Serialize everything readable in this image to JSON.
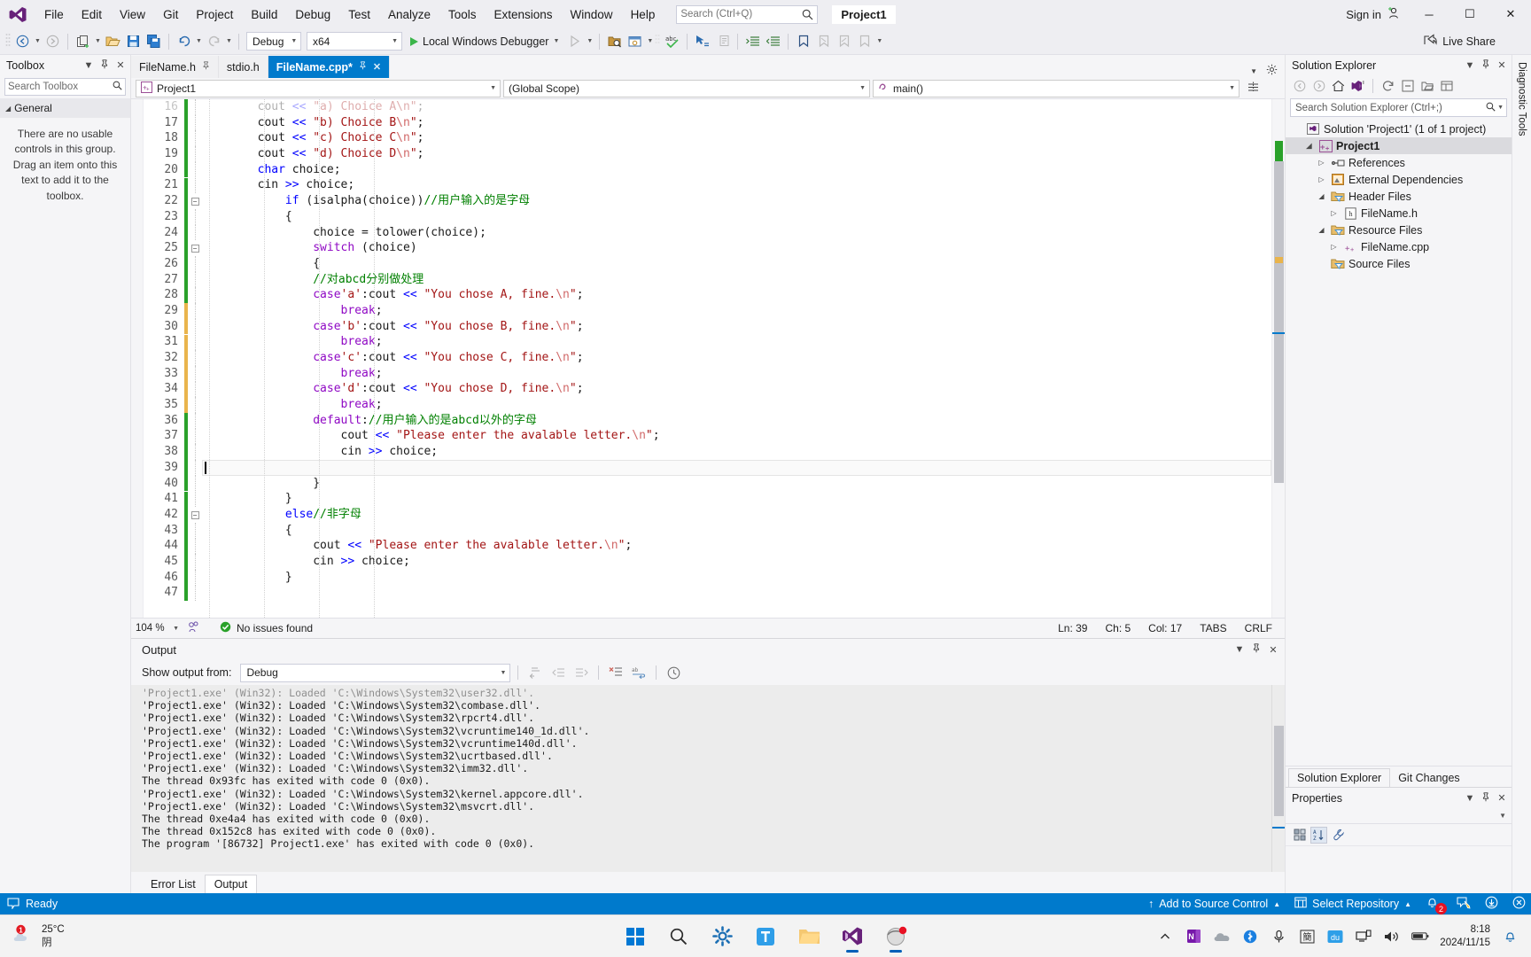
{
  "window": {
    "title": "Project1",
    "menu": [
      "File",
      "Edit",
      "View",
      "Git",
      "Project",
      "Build",
      "Debug",
      "Test",
      "Analyze",
      "Tools",
      "Extensions",
      "Window",
      "Help"
    ],
    "search_placeholder": "Search (Ctrl+Q)",
    "sign_in": "Sign in",
    "minimize": "─",
    "maximize": "☐",
    "close": "✕"
  },
  "toolbar": {
    "config": "Debug",
    "platform": "x64",
    "run_label": "Local Windows Debugger",
    "live_share": "Live Share"
  },
  "toolbox": {
    "title": "Toolbox",
    "search_placeholder": "Search Toolbox",
    "group": "General",
    "message": "There are no usable controls in this group. Drag an item onto this text to add it to the toolbox."
  },
  "tabs": [
    {
      "label": "FileName.h",
      "active": false,
      "pinned": true
    },
    {
      "label": "stdio.h",
      "active": false,
      "pinned": false
    },
    {
      "label": "FileName.cpp*",
      "active": true,
      "pinned": true
    }
  ],
  "navbar": {
    "project": "Project1",
    "scope": "(Global Scope)",
    "member": "main()"
  },
  "editor": {
    "zoom": "104 %",
    "issues": "No issues found",
    "ln": "Ln: 39",
    "ch": "Ch: 5",
    "col": "Col: 17",
    "tabs_mode": "TABS",
    "eol": "CRLF",
    "first_line": 16,
    "current_line": 39,
    "lines": [
      {
        "n": 16,
        "tokens": [
          {
            "t": "        cout ",
            "c": "op"
          },
          {
            "t": "<<",
            "c": "kw"
          },
          {
            "t": " ",
            "c": "op"
          },
          {
            "t": "\"a) Choice A\\n\"",
            "c": "str"
          },
          {
            "t": ";",
            "c": "op"
          }
        ],
        "mark": "green",
        "faded": true
      },
      {
        "n": 17,
        "tokens": [
          {
            "t": "        cout ",
            "c": "op"
          },
          {
            "t": "<<",
            "c": "kw"
          },
          {
            "t": " ",
            "c": "op"
          },
          {
            "t": "\"b) Choice B",
            "c": "str"
          },
          {
            "t": "\\n",
            "c": "esc"
          },
          {
            "t": "\"",
            "c": "str"
          },
          {
            "t": ";",
            "c": "op"
          }
        ],
        "mark": "green"
      },
      {
        "n": 18,
        "tokens": [
          {
            "t": "        cout ",
            "c": "op"
          },
          {
            "t": "<<",
            "c": "kw"
          },
          {
            "t": " ",
            "c": "op"
          },
          {
            "t": "\"c) Choice C",
            "c": "str"
          },
          {
            "t": "\\n",
            "c": "esc"
          },
          {
            "t": "\"",
            "c": "str"
          },
          {
            "t": ";",
            "c": "op"
          }
        ],
        "mark": "green"
      },
      {
        "n": 19,
        "tokens": [
          {
            "t": "        cout ",
            "c": "op"
          },
          {
            "t": "<<",
            "c": "kw"
          },
          {
            "t": " ",
            "c": "op"
          },
          {
            "t": "\"d) Choice D",
            "c": "str"
          },
          {
            "t": "\\n",
            "c": "esc"
          },
          {
            "t": "\"",
            "c": "str"
          },
          {
            "t": ";",
            "c": "op"
          }
        ],
        "mark": "green"
      },
      {
        "n": 20,
        "tokens": [
          {
            "t": "        ",
            "c": "op"
          },
          {
            "t": "char",
            "c": "kw"
          },
          {
            "t": " choice;",
            "c": "op"
          }
        ],
        "mark": "green"
      },
      {
        "n": 21,
        "tokens": [
          {
            "t": "        cin ",
            "c": "op"
          },
          {
            "t": ">>",
            "c": "kw"
          },
          {
            "t": " choice;",
            "c": "op"
          }
        ],
        "mark": "green"
      },
      {
        "n": 22,
        "tokens": [
          {
            "t": "            ",
            "c": "op"
          },
          {
            "t": "if",
            "c": "kw"
          },
          {
            "t": " (isalpha(choice))",
            "c": "op"
          },
          {
            "t": "//用户输入的是字母",
            "c": "cmt"
          }
        ],
        "mark": "green",
        "fold": "minus"
      },
      {
        "n": 23,
        "tokens": [
          {
            "t": "            {",
            "c": "op"
          }
        ],
        "mark": "green"
      },
      {
        "n": 24,
        "tokens": [
          {
            "t": "                choice = ",
            "c": "op"
          },
          {
            "t": "tolower",
            "c": "op"
          },
          {
            "t": "(choice);",
            "c": "op"
          }
        ],
        "mark": "green"
      },
      {
        "n": 25,
        "tokens": [
          {
            "t": "                ",
            "c": "op"
          },
          {
            "t": "switch",
            "c": "kw2"
          },
          {
            "t": " (choice)",
            "c": "op"
          }
        ],
        "mark": "green",
        "fold": "minus"
      },
      {
        "n": 26,
        "tokens": [
          {
            "t": "                {",
            "c": "op"
          }
        ],
        "mark": "green"
      },
      {
        "n": 27,
        "tokens": [
          {
            "t": "                ",
            "c": "op"
          },
          {
            "t": "//对abcd分别做处理",
            "c": "cmt"
          }
        ],
        "mark": "green"
      },
      {
        "n": 28,
        "tokens": [
          {
            "t": "                ",
            "c": "op"
          },
          {
            "t": "case",
            "c": "kw2"
          },
          {
            "t": "'a'",
            "c": "str"
          },
          {
            "t": ":cout ",
            "c": "op"
          },
          {
            "t": "<<",
            "c": "kw"
          },
          {
            "t": " ",
            "c": "op"
          },
          {
            "t": "\"You chose A, fine.",
            "c": "str"
          },
          {
            "t": "\\n",
            "c": "esc"
          },
          {
            "t": "\"",
            "c": "str"
          },
          {
            "t": ";",
            "c": "op"
          }
        ],
        "mark": "green"
      },
      {
        "n": 29,
        "tokens": [
          {
            "t": "                    ",
            "c": "op"
          },
          {
            "t": "break",
            "c": "kw2"
          },
          {
            "t": ";",
            "c": "op"
          }
        ],
        "mark": "yellow"
      },
      {
        "n": 30,
        "tokens": [
          {
            "t": "                ",
            "c": "op"
          },
          {
            "t": "case",
            "c": "kw2"
          },
          {
            "t": "'b'",
            "c": "str"
          },
          {
            "t": ":cout ",
            "c": "op"
          },
          {
            "t": "<<",
            "c": "kw"
          },
          {
            "t": " ",
            "c": "op"
          },
          {
            "t": "\"You chose B, fine.",
            "c": "str"
          },
          {
            "t": "\\n",
            "c": "esc"
          },
          {
            "t": "\"",
            "c": "str"
          },
          {
            "t": ";",
            "c": "op"
          }
        ],
        "mark": "yellow"
      },
      {
        "n": 31,
        "tokens": [
          {
            "t": "                    ",
            "c": "op"
          },
          {
            "t": "break",
            "c": "kw2"
          },
          {
            "t": ";",
            "c": "op"
          }
        ],
        "mark": "yellow"
      },
      {
        "n": 32,
        "tokens": [
          {
            "t": "                ",
            "c": "op"
          },
          {
            "t": "case",
            "c": "kw2"
          },
          {
            "t": "'c'",
            "c": "str"
          },
          {
            "t": ":cout ",
            "c": "op"
          },
          {
            "t": "<<",
            "c": "kw"
          },
          {
            "t": " ",
            "c": "op"
          },
          {
            "t": "\"You chose C, fine.",
            "c": "str"
          },
          {
            "t": "\\n",
            "c": "esc"
          },
          {
            "t": "\"",
            "c": "str"
          },
          {
            "t": ";",
            "c": "op"
          }
        ],
        "mark": "yellow"
      },
      {
        "n": 33,
        "tokens": [
          {
            "t": "                    ",
            "c": "op"
          },
          {
            "t": "break",
            "c": "kw2"
          },
          {
            "t": ";",
            "c": "op"
          }
        ],
        "mark": "yellow"
      },
      {
        "n": 34,
        "tokens": [
          {
            "t": "                ",
            "c": "op"
          },
          {
            "t": "case",
            "c": "kw2"
          },
          {
            "t": "'d'",
            "c": "str"
          },
          {
            "t": ":cout ",
            "c": "op"
          },
          {
            "t": "<<",
            "c": "kw"
          },
          {
            "t": " ",
            "c": "op"
          },
          {
            "t": "\"You chose D, fine.",
            "c": "str"
          },
          {
            "t": "\\n",
            "c": "esc"
          },
          {
            "t": "\"",
            "c": "str"
          },
          {
            "t": ";",
            "c": "op"
          }
        ],
        "mark": "yellow"
      },
      {
        "n": 35,
        "tokens": [
          {
            "t": "                    ",
            "c": "op"
          },
          {
            "t": "break",
            "c": "kw2"
          },
          {
            "t": ";",
            "c": "op"
          }
        ],
        "mark": "yellow"
      },
      {
        "n": 36,
        "tokens": [
          {
            "t": "                ",
            "c": "op"
          },
          {
            "t": "default",
            "c": "kw2"
          },
          {
            "t": ":",
            "c": "op"
          },
          {
            "t": "//用户输入的是abcd以外的字母",
            "c": "cmt"
          }
        ],
        "mark": "green"
      },
      {
        "n": 37,
        "tokens": [
          {
            "t": "                    cout ",
            "c": "op"
          },
          {
            "t": "<<",
            "c": "kw"
          },
          {
            "t": " ",
            "c": "op"
          },
          {
            "t": "\"Please enter the avalable letter.",
            "c": "str"
          },
          {
            "t": "\\n",
            "c": "esc"
          },
          {
            "t": "\"",
            "c": "str"
          },
          {
            "t": ";",
            "c": "op"
          }
        ],
        "mark": "green"
      },
      {
        "n": 38,
        "tokens": [
          {
            "t": "                    cin ",
            "c": "op"
          },
          {
            "t": ">>",
            "c": "kw"
          },
          {
            "t": " choice;",
            "c": "op"
          }
        ],
        "mark": "green"
      },
      {
        "n": 39,
        "tokens": [
          {
            "t": "",
            "c": "op"
          }
        ],
        "mark": "green"
      },
      {
        "n": 40,
        "tokens": [
          {
            "t": "                }",
            "c": "op"
          }
        ],
        "mark": "green"
      },
      {
        "n": 41,
        "tokens": [
          {
            "t": "            }",
            "c": "op"
          }
        ],
        "mark": "green"
      },
      {
        "n": 42,
        "tokens": [
          {
            "t": "            ",
            "c": "op"
          },
          {
            "t": "else",
            "c": "kw"
          },
          {
            "t": "//非字母",
            "c": "cmt"
          }
        ],
        "mark": "green",
        "fold": "minus"
      },
      {
        "n": 43,
        "tokens": [
          {
            "t": "            {",
            "c": "op"
          }
        ],
        "mark": "green"
      },
      {
        "n": 44,
        "tokens": [
          {
            "t": "                cout ",
            "c": "op"
          },
          {
            "t": "<<",
            "c": "kw"
          },
          {
            "t": " ",
            "c": "op"
          },
          {
            "t": "\"Please enter the avalable letter.",
            "c": "str"
          },
          {
            "t": "\\n",
            "c": "esc"
          },
          {
            "t": "\"",
            "c": "str"
          },
          {
            "t": ";",
            "c": "op"
          }
        ],
        "mark": "green"
      },
      {
        "n": 45,
        "tokens": [
          {
            "t": "                cin ",
            "c": "op"
          },
          {
            "t": ">>",
            "c": "kw"
          },
          {
            "t": " choice;",
            "c": "op"
          }
        ],
        "mark": "green"
      },
      {
        "n": 46,
        "tokens": [
          {
            "t": "            }",
            "c": "op"
          }
        ],
        "mark": "green"
      },
      {
        "n": 47,
        "tokens": [
          {
            "t": "",
            "c": "op"
          }
        ],
        "mark": "green"
      }
    ]
  },
  "output": {
    "title": "Output",
    "show_from_label": "Show output from:",
    "show_from_value": "Debug",
    "lines": [
      "'Project1.exe' (Win32): Loaded 'C:\\Windows\\System32\\user32.dll'.",
      "'Project1.exe' (Win32): Loaded 'C:\\Windows\\System32\\combase.dll'.",
      "'Project1.exe' (Win32): Loaded 'C:\\Windows\\System32\\rpcrt4.dll'.",
      "'Project1.exe' (Win32): Loaded 'C:\\Windows\\System32\\vcruntime140_1d.dll'.",
      "'Project1.exe' (Win32): Loaded 'C:\\Windows\\System32\\vcruntime140d.dll'.",
      "'Project1.exe' (Win32): Loaded 'C:\\Windows\\System32\\ucrtbased.dll'.",
      "'Project1.exe' (Win32): Loaded 'C:\\Windows\\System32\\imm32.dll'.",
      "The thread 0x93fc has exited with code 0 (0x0).",
      "'Project1.exe' (Win32): Loaded 'C:\\Windows\\System32\\kernel.appcore.dll'.",
      "'Project1.exe' (Win32): Loaded 'C:\\Windows\\System32\\msvcrt.dll'.",
      "The thread 0xe4a4 has exited with code 0 (0x0).",
      "The thread 0x152c8 has exited with code 0 (0x0).",
      "The program '[86732] Project1.exe' has exited with code 0 (0x0)."
    ],
    "tabs": [
      {
        "label": "Error List",
        "active": false
      },
      {
        "label": "Output",
        "active": true
      }
    ]
  },
  "solution_explorer": {
    "title": "Solution Explorer",
    "search_placeholder": "Search Solution Explorer (Ctrl+;)",
    "tree": [
      {
        "depth": 0,
        "twisty": "",
        "icon": "solution-icon",
        "label": "Solution 'Project1' (1 of 1 project)",
        "selected": false
      },
      {
        "depth": 1,
        "twisty": "open",
        "icon": "cpp-project-icon",
        "label": "Project1",
        "selected": true
      },
      {
        "depth": 2,
        "twisty": "closed",
        "icon": "references-icon",
        "label": "References",
        "selected": false
      },
      {
        "depth": 2,
        "twisty": "closed",
        "icon": "dependencies-icon",
        "label": "External Dependencies",
        "selected": false
      },
      {
        "depth": 2,
        "twisty": "open",
        "icon": "filter-folder-icon",
        "label": "Header Files",
        "selected": false
      },
      {
        "depth": 3,
        "twisty": "closed",
        "icon": "header-file-icon",
        "label": "FileName.h",
        "selected": false
      },
      {
        "depth": 2,
        "twisty": "open",
        "icon": "filter-folder-icon",
        "label": "Resource Files",
        "selected": false
      },
      {
        "depth": 3,
        "twisty": "closed",
        "icon": "cpp-file-icon",
        "label": "FileName.cpp",
        "selected": false
      },
      {
        "depth": 2,
        "twisty": "",
        "icon": "filter-folder-icon",
        "label": "Source Files",
        "selected": false
      }
    ],
    "tabs": [
      {
        "label": "Solution Explorer",
        "active": true
      },
      {
        "label": "Git Changes",
        "active": false
      }
    ]
  },
  "properties": {
    "title": "Properties"
  },
  "vertical_strips": {
    "diagnostic_tools": "Diagnostic Tools"
  },
  "status_bar": {
    "ready": "Ready",
    "add_to_source_control": "Add to Source Control",
    "select_repository": "Select Repository",
    "notification_count": "2"
  },
  "taskbar": {
    "weather_temp": "25°C",
    "weather_desc": "阴",
    "time": "8:18",
    "date": "2024/11/15"
  },
  "colors": {
    "accent": "#007acc",
    "tab_active": "#007acc",
    "vs_purple": "#68217a",
    "keyword_blue": "#0000ff",
    "keyword_purple": "#8f08c4",
    "string_red": "#a31515",
    "comment_green": "#008000",
    "change_green": "#2aa12a",
    "change_yellow": "#e9b44c",
    "badge_red": "#e81123"
  }
}
